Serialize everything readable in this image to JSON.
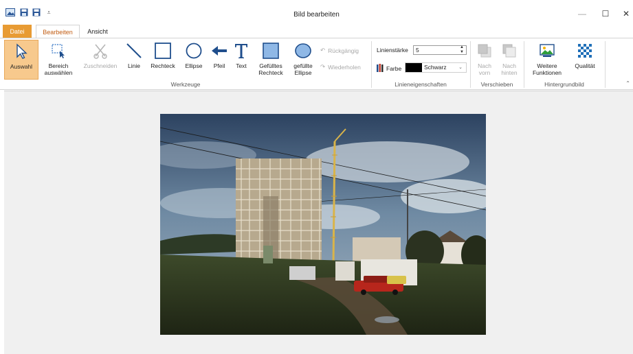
{
  "window": {
    "title": "Bild bearbeiten",
    "controls": {
      "minimize": "—",
      "maximize": "☐",
      "close": "✕"
    }
  },
  "tabs": [
    {
      "label": "Datei"
    },
    {
      "label": "Bearbeiten"
    },
    {
      "label": "Ansicht"
    }
  ],
  "ribbon": {
    "groups": {
      "werkzeuge": "Werkzeuge",
      "linieneigenschaften": "Linieneigenschaften",
      "verschieben": "Verschieben",
      "hintergrundbild": "Hintergrundbild"
    },
    "tools": {
      "auswahl": "Auswahl",
      "bereich": "Bereich auswählen",
      "zuschneiden": "Zuschneiden",
      "linie": "Linie",
      "rechteck": "Rechteck",
      "ellipse": "Ellipse",
      "pfeil": "Pfeil",
      "text": "Text",
      "gef_rechteck": "Gefülltes Rechteck",
      "gef_ellipse": "gefüllte Ellipse"
    },
    "undo": "Rückgängig",
    "redo": "Wiederholen",
    "line_props": {
      "width_label": "Linienstärke",
      "width_value": "5",
      "color_label": "Farbe",
      "color_value": "Schwarz",
      "color_hex": "#000000"
    },
    "move": {
      "front": "Nach vorn",
      "back": "Nach hinten"
    },
    "background": {
      "more": "Weitere Funktionen",
      "quality": "Qualität"
    }
  },
  "colors": {
    "accent_orange": "#e89b33",
    "active_tab_text": "#c25d13",
    "selected_tool_bg": "#f7c98d"
  }
}
